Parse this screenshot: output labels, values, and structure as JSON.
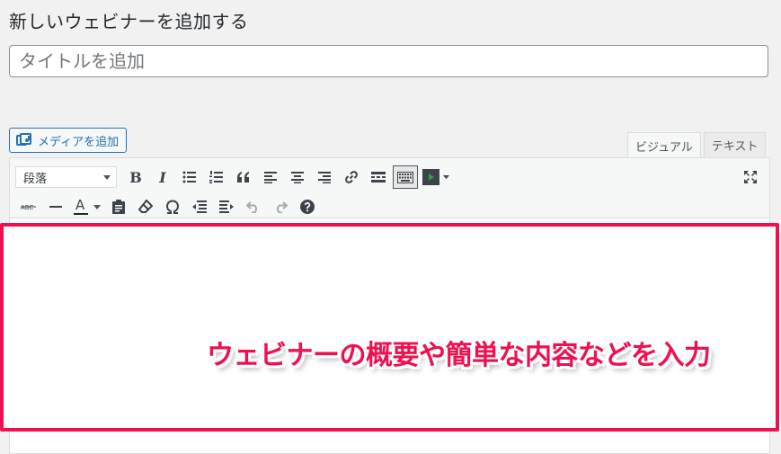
{
  "header": {
    "title": "新しいウェビナーを追加する"
  },
  "title_field": {
    "placeholder": "タイトルを追加",
    "value": ""
  },
  "media_button": {
    "label": "メディアを追加",
    "icon": "media-icon"
  },
  "editor_tabs": [
    {
      "label": "ビジュアル",
      "active": true
    },
    {
      "label": "テキスト",
      "active": false
    }
  ],
  "toolbar": {
    "format_select": {
      "selected": "段落"
    },
    "row1": [
      "bold",
      "italic",
      "bulleted-list",
      "numbered-list",
      "blockquote",
      "align-left",
      "align-center",
      "align-right",
      "insert-link",
      "read-more",
      "toolbar-toggle",
      "media-player"
    ],
    "row2": [
      "strikethrough",
      "horizontal-line",
      "text-color",
      "paste-as-text",
      "clear-formatting",
      "special-character",
      "outdent",
      "indent",
      "undo",
      "redo",
      "keyboard-shortcuts"
    ],
    "row1_labels": {
      "bold": "B",
      "italic": "I"
    },
    "text_color_label": "A",
    "text_color_value": "#23282d"
  },
  "annotation": {
    "text": "ウェビナーの概要や簡単な内容などを入力",
    "color": "#f0104f"
  },
  "colors": {
    "accent": "#2271b1",
    "highlight": "#f0104f",
    "background": "#f1f1f1"
  }
}
